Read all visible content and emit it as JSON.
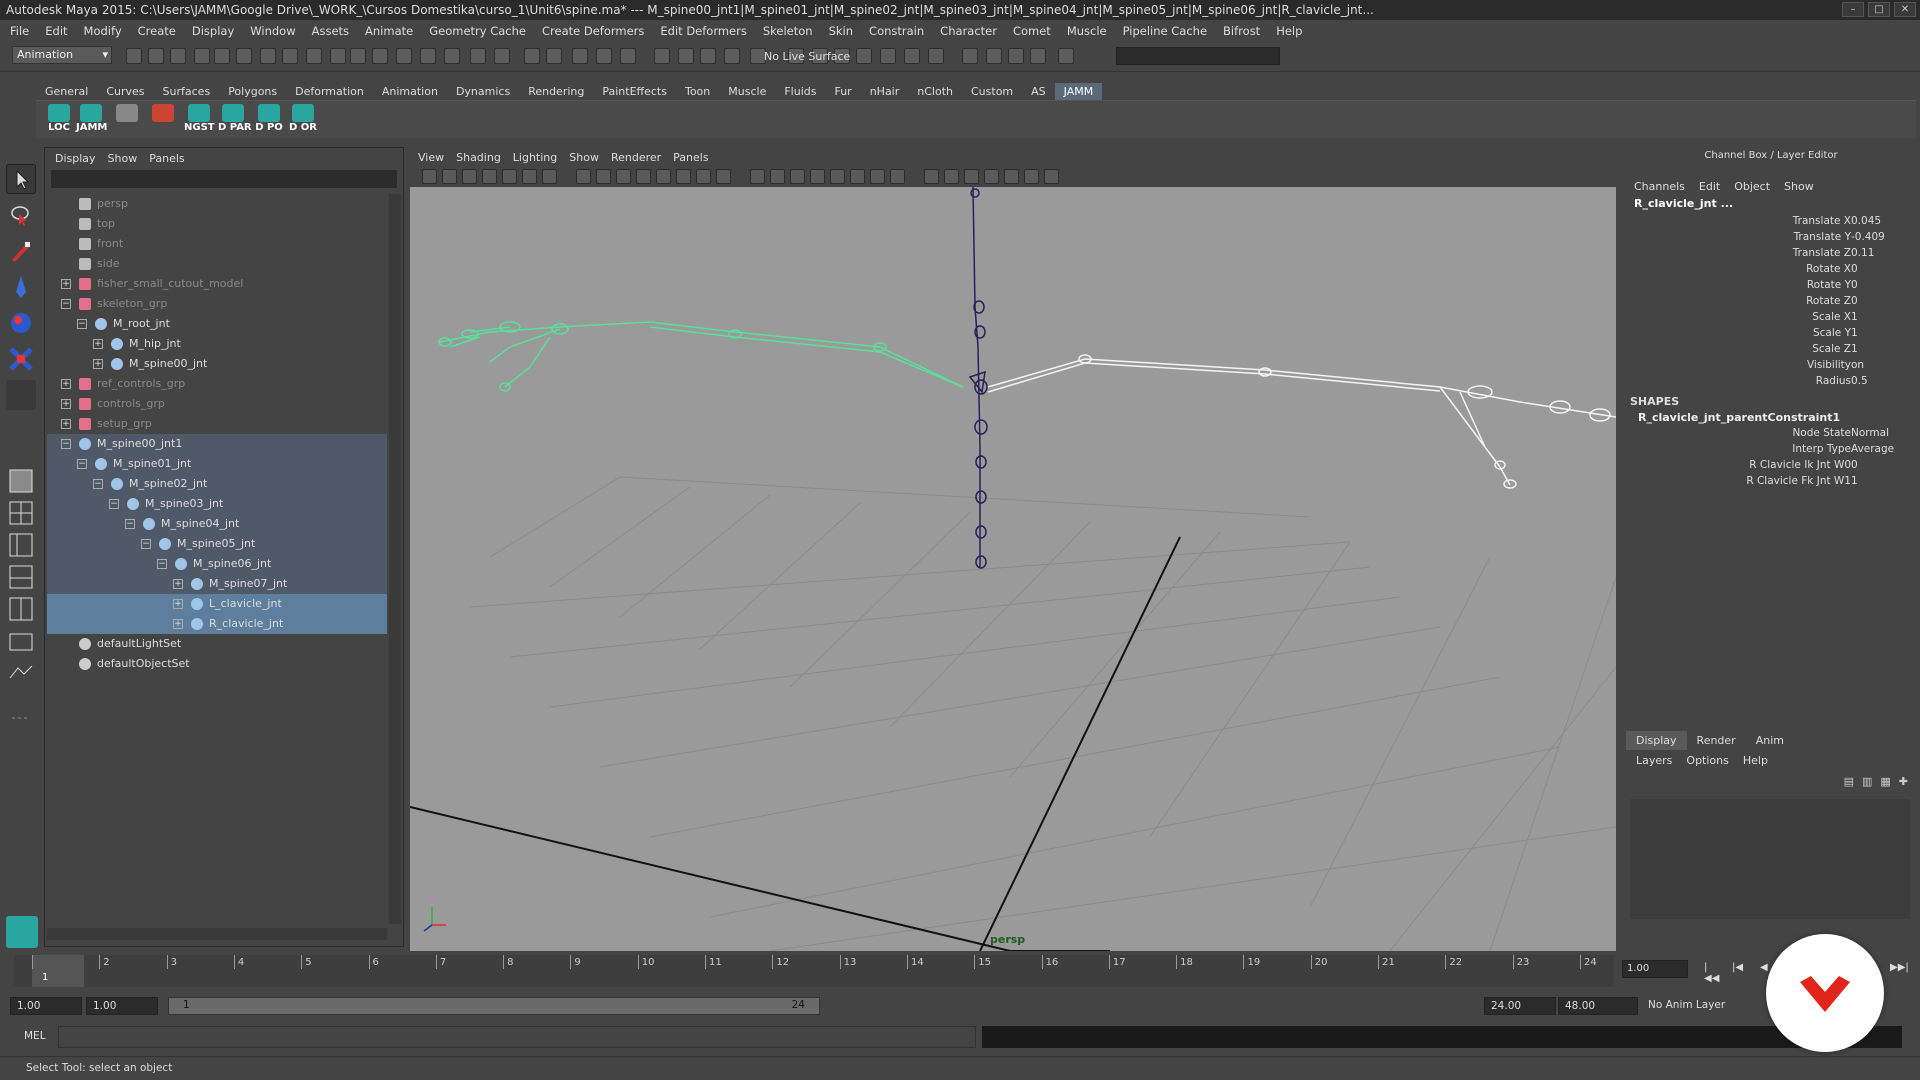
{
  "window": {
    "title": "Autodesk Maya 2015: C:\\Users\\JAMM\\Google Drive\\_WORK_\\Cursos Domestika\\curso_1\\Unit6\\spine.ma*   ---   M_spine00_jnt1|M_spine01_jnt|M_spine02_jnt|M_spine03_jnt|M_spine04_jnt|M_spine05_jnt|M_spine06_jnt|R_clavicle_jnt...",
    "controls": [
      "minimize",
      "maximize",
      "close"
    ]
  },
  "menubar": [
    "File",
    "Edit",
    "Modify",
    "Create",
    "Display",
    "Window",
    "Assets",
    "Animate",
    "Geometry Cache",
    "Create Deformers",
    "Edit Deformers",
    "Skeleton",
    "Skin",
    "Constrain",
    "Character",
    "Comet",
    "Muscle",
    "Pipeline Cache",
    "Bifrost",
    "Help"
  ],
  "statusline": {
    "mode": "Animation",
    "live_surface": "No Live Surface"
  },
  "shelf": {
    "tabs": [
      "General",
      "Curves",
      "Surfaces",
      "Polygons",
      "Deformation",
      "Animation",
      "Dynamics",
      "Rendering",
      "PaintEffects",
      "Toon",
      "Muscle",
      "Fluids",
      "Fur",
      "nHair",
      "nCloth",
      "Custom",
      "AS",
      "JAMM"
    ],
    "active_tab": "JAMM",
    "buttons": [
      "LOC",
      "JAMM",
      "",
      "",
      "NGST",
      "D PAR",
      "D PO",
      "D OR"
    ]
  },
  "outliner": {
    "menu": [
      "Display",
      "Show",
      "Panels"
    ],
    "items": [
      {
        "label": "persp",
        "type": "camera",
        "depth": 1,
        "dim": true
      },
      {
        "label": "top",
        "type": "camera",
        "depth": 1,
        "dim": true
      },
      {
        "label": "front",
        "type": "camera",
        "depth": 1,
        "dim": true
      },
      {
        "label": "side",
        "type": "camera",
        "depth": 1,
        "dim": true
      },
      {
        "label": "fisher_small_cutout_model",
        "type": "group",
        "depth": 1,
        "exp": "+",
        "dim": true
      },
      {
        "label": "skeleton_grp",
        "type": "group",
        "depth": 1,
        "exp": "-",
        "dim": true
      },
      {
        "label": "M_root_jnt",
        "type": "joint",
        "depth": 2,
        "exp": "-"
      },
      {
        "label": "M_hip_jnt",
        "type": "joint",
        "depth": 3,
        "exp": "+"
      },
      {
        "label": "M_spine00_jnt",
        "type": "joint",
        "depth": 3,
        "exp": "+"
      },
      {
        "label": "ref_controls_grp",
        "type": "group",
        "depth": 1,
        "exp": "+",
        "dim": true
      },
      {
        "label": "controls_grp",
        "type": "group",
        "depth": 1,
        "exp": "+",
        "dim": true
      },
      {
        "label": "setup_grp",
        "type": "group",
        "depth": 1,
        "exp": "+",
        "dim": true
      },
      {
        "label": "M_spine00_jnt1",
        "type": "joint",
        "depth": 1,
        "exp": "-",
        "state": "hl"
      },
      {
        "label": "M_spine01_jnt",
        "type": "joint",
        "depth": 2,
        "exp": "-",
        "state": "hl"
      },
      {
        "label": "M_spine02_jnt",
        "type": "joint",
        "depth": 3,
        "exp": "-",
        "state": "hl"
      },
      {
        "label": "M_spine03_jnt",
        "type": "joint",
        "depth": 4,
        "exp": "-",
        "state": "hl"
      },
      {
        "label": "M_spine04_jnt",
        "type": "joint",
        "depth": 5,
        "exp": "-",
        "state": "hl"
      },
      {
        "label": "M_spine05_jnt",
        "type": "joint",
        "depth": 6,
        "exp": "-",
        "state": "hl"
      },
      {
        "label": "M_spine06_jnt",
        "type": "joint",
        "depth": 7,
        "exp": "-",
        "state": "hl"
      },
      {
        "label": "M_spine07_jnt",
        "type": "joint",
        "depth": 8,
        "exp": "+",
        "state": "hl"
      },
      {
        "label": "L_clavicle_jnt",
        "type": "joint",
        "depth": 8,
        "exp": "+",
        "state": "sel"
      },
      {
        "label": "R_clavicle_jnt",
        "type": "joint",
        "depth": 8,
        "exp": "+",
        "state": "sel"
      },
      {
        "label": "defaultLightSet",
        "type": "set",
        "depth": 1
      },
      {
        "label": "defaultObjectSet",
        "type": "set",
        "depth": 1
      }
    ]
  },
  "viewport": {
    "menu": [
      "View",
      "Shading",
      "Lighting",
      "Show",
      "Renderer",
      "Panels"
    ],
    "camera_label": "persp"
  },
  "channelbox": {
    "header": "Channel Box / Layer Editor",
    "menu": [
      "Channels",
      "Edit",
      "Object",
      "Show"
    ],
    "object": "R_clavicle_jnt ...",
    "attributes": [
      {
        "name": "Translate X",
        "value": "0.045"
      },
      {
        "name": "Translate Y",
        "value": "-0.409"
      },
      {
        "name": "Translate Z",
        "value": "0.11"
      },
      {
        "name": "Rotate X",
        "value": "0"
      },
      {
        "name": "Rotate Y",
        "value": "0"
      },
      {
        "name": "Rotate Z",
        "value": "0"
      },
      {
        "name": "Scale X",
        "value": "1"
      },
      {
        "name": "Scale Y",
        "value": "1"
      },
      {
        "name": "Scale Z",
        "value": "1"
      },
      {
        "name": "Visibility",
        "value": "on"
      },
      {
        "name": "Radius",
        "value": "0.5"
      }
    ],
    "shapes_header": "SHAPES",
    "constraint_name": "R_clavicle_jnt_parentConstraint1",
    "constraint_attrs": [
      {
        "name": "Node State",
        "value": "Normal"
      },
      {
        "name": "Interp Type",
        "value": "Average"
      },
      {
        "name": "R Clavicle Ik Jnt W0",
        "value": "0"
      },
      {
        "name": "R Clavicle Fk Jnt W1",
        "value": "1"
      }
    ]
  },
  "layereditor": {
    "tabs": [
      "Display",
      "Render",
      "Anim"
    ],
    "active_tab": "Display",
    "menu": [
      "Layers",
      "Options",
      "Help"
    ]
  },
  "timeslider": {
    "start": 1,
    "end": 24,
    "current": 1,
    "labels": [
      "1",
      "2",
      "3",
      "4",
      "5",
      "6",
      "7",
      "8",
      "9",
      "10",
      "11",
      "12",
      "13",
      "14",
      "15",
      "16",
      "17",
      "18",
      "19",
      "20",
      "21",
      "22",
      "23",
      "24"
    ],
    "current_frame_field": "1.00"
  },
  "range": {
    "start_time": "1.00",
    "playback_start": "1.00",
    "slider_start": "1",
    "slider_end": "24",
    "playback_end": "24.00",
    "end_time": "48.00",
    "anim_layer": "No Anim Layer"
  },
  "commandline": {
    "label": "MEL"
  },
  "helpline": {
    "text": "Select Tool: select an object"
  },
  "colors": {
    "selection": "#5d7e9d",
    "highlight": "#4f5968",
    "joint_green": "#59e09a",
    "viewport_bg": "#9a9a9a",
    "brand_red": "#e1251b"
  }
}
